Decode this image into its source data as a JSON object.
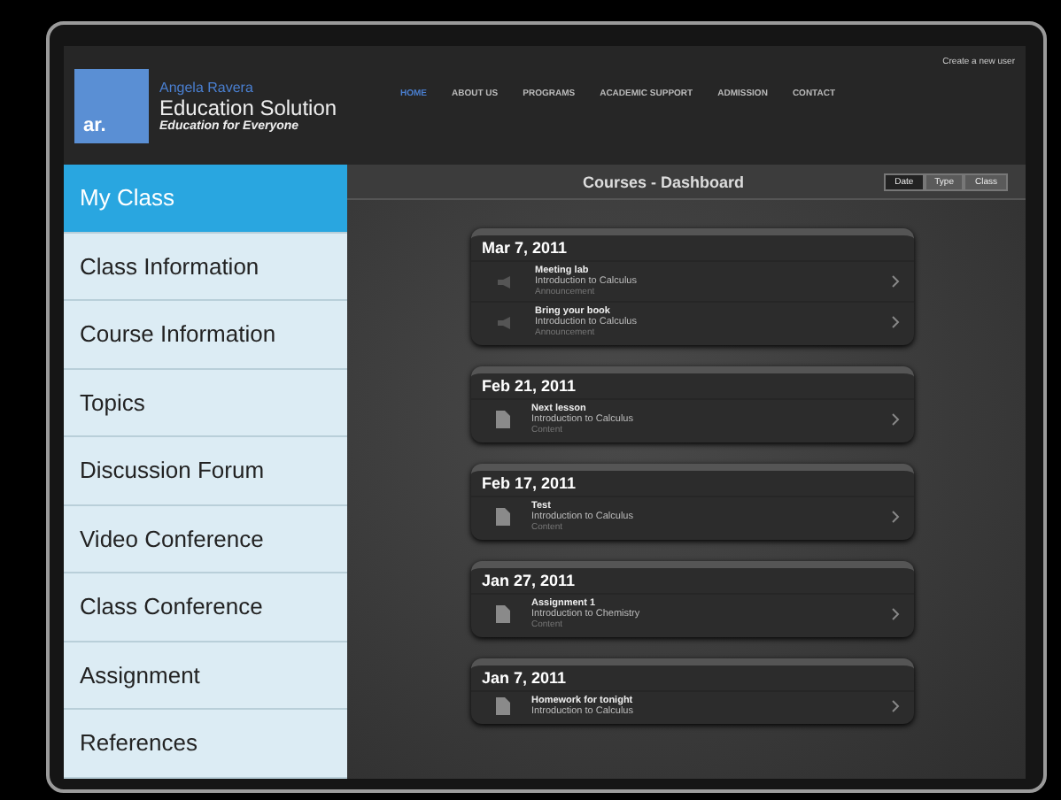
{
  "header": {
    "logo_mark": "ar.",
    "owner": "Angela Ravera",
    "brand": "Education Solution",
    "tagline": "Education for Everyone",
    "top_link": "Create a new user",
    "nav": [
      {
        "label": "HOME",
        "selected": true
      },
      {
        "label": "ABOUT US",
        "selected": false
      },
      {
        "label": "PROGRAMS",
        "selected": false
      },
      {
        "label": "ACADEMIC SUPPORT",
        "selected": false
      },
      {
        "label": "ADMISSION",
        "selected": false
      },
      {
        "label": "CONTACT",
        "selected": false
      }
    ]
  },
  "sidebar": {
    "items": [
      {
        "label": "My Class",
        "selected": true
      },
      {
        "label": "Class Information",
        "selected": false
      },
      {
        "label": "Course Information",
        "selected": false
      },
      {
        "label": "Topics",
        "selected": false
      },
      {
        "label": "Discussion Forum",
        "selected": false
      },
      {
        "label": "Video Conference",
        "selected": false
      },
      {
        "label": "Class Conference",
        "selected": false
      },
      {
        "label": "Assignment",
        "selected": false
      },
      {
        "label": "References",
        "selected": false
      }
    ]
  },
  "main": {
    "title": "Courses - Dashboard",
    "sort_buttons": [
      {
        "label": "Date",
        "selected": true
      },
      {
        "label": "Type",
        "selected": false
      },
      {
        "label": "Class",
        "selected": false
      }
    ],
    "days": [
      {
        "date": "Mar 7, 2011",
        "entries": [
          {
            "kind": "announcement",
            "title": "Meeting lab",
            "course": "Introduction to Calculus",
            "type": "Announcement"
          },
          {
            "kind": "announcement",
            "title": "Bring your book",
            "course": "Introduction to Calculus",
            "type": "Announcement"
          }
        ]
      },
      {
        "date": "Feb 21, 2011",
        "entries": [
          {
            "kind": "content",
            "title": "Next lesson",
            "course": "Introduction to Calculus",
            "type": "Content"
          }
        ]
      },
      {
        "date": "Feb 17, 2011",
        "entries": [
          {
            "kind": "content",
            "title": "Test",
            "course": "Introduction to Calculus",
            "type": "Content"
          }
        ]
      },
      {
        "date": "Jan 27, 2011",
        "entries": [
          {
            "kind": "content",
            "title": "Assignment 1",
            "course": "Introduction to Chemistry",
            "type": "Content"
          }
        ]
      },
      {
        "date": "Jan 7, 2011",
        "entries": [
          {
            "kind": "content",
            "title": "Homework for tonight",
            "course": "Introduction to Calculus"
          }
        ]
      }
    ]
  }
}
